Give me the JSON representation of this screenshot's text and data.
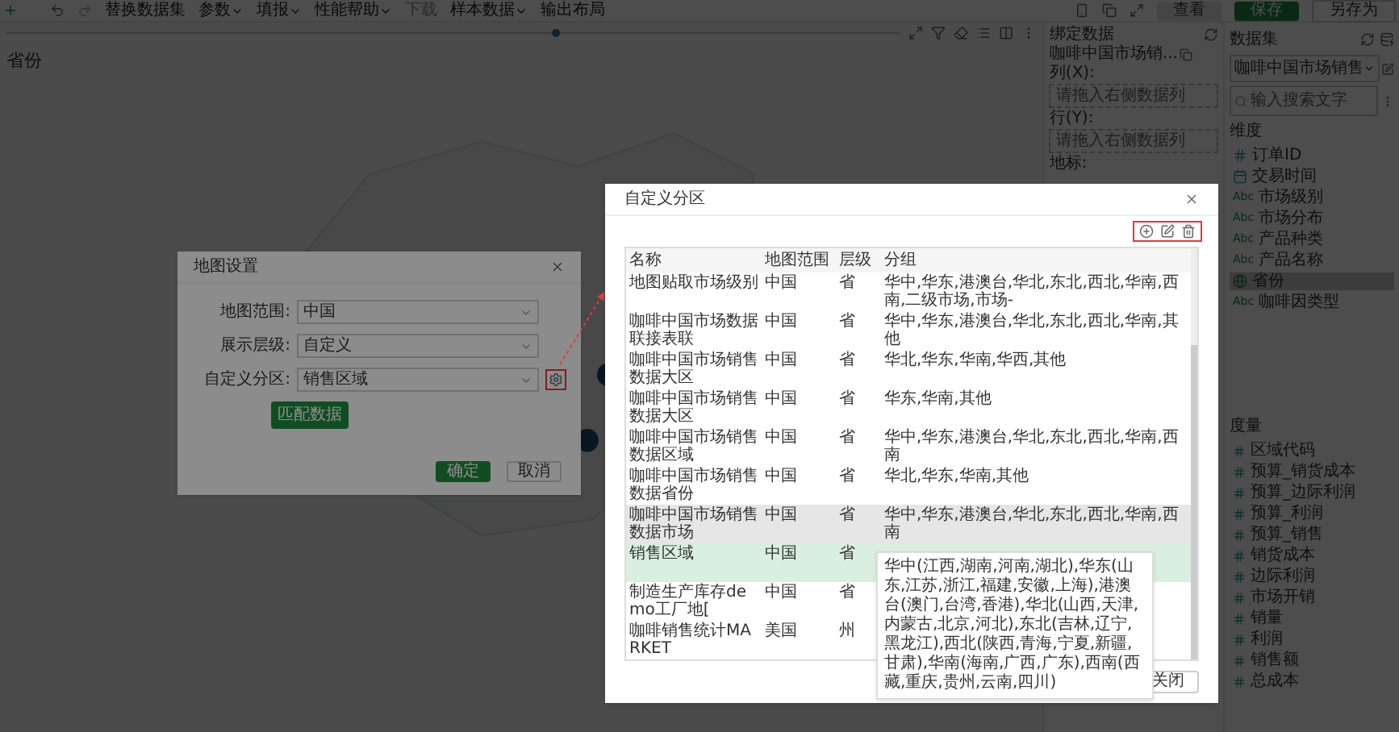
{
  "toolbar": {
    "menus": [
      {
        "label": "替换数据集",
        "dropdown": false,
        "disabled": false
      },
      {
        "label": "参数",
        "dropdown": true,
        "disabled": false
      },
      {
        "label": "填报",
        "dropdown": true,
        "disabled": false
      },
      {
        "label": "性能帮助",
        "dropdown": true,
        "disabled": false
      },
      {
        "label": "下载",
        "dropdown": false,
        "disabled": true
      },
      {
        "label": "样本数据",
        "dropdown": true,
        "disabled": false
      },
      {
        "label": "输出布局",
        "dropdown": false,
        "disabled": false
      }
    ],
    "actions": [
      {
        "label": "查看",
        "kind": "plain"
      },
      {
        "label": "保存",
        "kind": "primary"
      },
      {
        "label": "另存为",
        "kind": "outline"
      }
    ]
  },
  "chart": {
    "title": "省份"
  },
  "binding_panel": {
    "title": "绑定数据",
    "dataset": "咖啡中国市场销...",
    "sections": [
      {
        "label": "列(X):",
        "placeholder": "请拖入右侧数据列"
      },
      {
        "label": "行(Y):",
        "placeholder": "请拖入右侧数据列"
      }
    ],
    "marker_label": "地标:"
  },
  "dataset_panel": {
    "title": "数据集",
    "dataset": "咖啡中国市场销售",
    "search": {
      "placeholder": "输入搜索文字"
    },
    "dimensions": {
      "title": "维度",
      "items": [
        {
          "name": "订单ID",
          "kind": "number",
          "selected": false
        },
        {
          "name": "交易时间",
          "kind": "date",
          "selected": false
        },
        {
          "name": "市场级别",
          "kind": "text",
          "badge": "Abc",
          "selected": false
        },
        {
          "name": "市场分布",
          "kind": "text",
          "badge": "Abc",
          "selected": false
        },
        {
          "name": "产品种类",
          "kind": "text",
          "badge": "Abc",
          "selected": false
        },
        {
          "name": "产品名称",
          "kind": "text",
          "badge": "Abc",
          "selected": false
        },
        {
          "name": "省份",
          "kind": "geo",
          "selected": true
        },
        {
          "name": "咖啡因类型",
          "kind": "text",
          "badge": "Abc",
          "selected": false
        }
      ]
    },
    "measures": {
      "title": "度量",
      "items": [
        "区域代码",
        "预算_销货成本",
        "预算_边际利润",
        "预算_利润",
        "预算_销售",
        "销货成本",
        "边际利润",
        "市场开销",
        "销量",
        "利润",
        "销售额",
        "总成本"
      ]
    }
  },
  "map_settings_dialog": {
    "title": "地图设置",
    "fields": [
      {
        "label": "地图范围:",
        "value": "中国",
        "settings": false
      },
      {
        "label": "展示层级:",
        "value": "自定义",
        "settings": false
      },
      {
        "label": "自定义分区:",
        "value": "销售区域",
        "settings": true
      }
    ],
    "match_button": "匹配数据",
    "buttons": [
      {
        "label": "确定",
        "kind": "primary"
      },
      {
        "label": "取消",
        "kind": "secondary"
      }
    ]
  },
  "custom_partition_dialog": {
    "title": "自定义分区",
    "columns": [
      "名称",
      "地图范围",
      "层级",
      "分组"
    ],
    "rows": [
      {
        "name": "地图贴取市场级别",
        "range": "中国",
        "level": "省",
        "group": "华中,华东,港澳台,华北,东北,西北,华南,西南,二级市场,市场-",
        "selected": false,
        "hovered": false
      },
      {
        "name": "咖啡中国市场数据联接表联",
        "range": "中国",
        "level": "省",
        "group": "华中,华东,港澳台,华北,东北,西北,华南,其他",
        "selected": false,
        "hovered": false
      },
      {
        "name": "咖啡中国市场销售数据大区",
        "range": "中国",
        "level": "省",
        "group": "华北,华东,华南,华西,其他",
        "selected": false,
        "hovered": false
      },
      {
        "name": "咖啡中国市场销售数据大区",
        "range": "中国",
        "level": "省",
        "group": "华东,华南,其他",
        "selected": false,
        "hovered": false
      },
      {
        "name": "咖啡中国市场销售数据区域",
        "range": "中国",
        "level": "省",
        "group": "华中,华东,港澳台,华北,东北,西北,华南,西南",
        "selected": false,
        "hovered": false
      },
      {
        "name": "咖啡中国市场销售数据省份",
        "range": "中国",
        "level": "省",
        "group": "华北,华东,华南,其他",
        "selected": false,
        "hovered": false
      },
      {
        "name": "咖啡中国市场销售数据市场",
        "range": "中国",
        "level": "省",
        "group": "华中,华东,港澳台,华北,东北,西北,华南,西南",
        "selected": false,
        "hovered": true
      },
      {
        "name": "销售区域",
        "range": "中国",
        "level": "省",
        "selected": true,
        "hovered": false
      },
      {
        "name": "制造生产库存demo工厂地[",
        "range": "中国",
        "level": "省",
        "selected": false,
        "hovered": false
      },
      {
        "name": "咖啡销售统计MARKET",
        "range": "美国",
        "level": "州",
        "selected": false,
        "hovered": false
      }
    ],
    "tooltip": "华中(江西,湖南,河南,湖北),华东(山东,江苏,浙江,福建,安徽,上海),港澳台(澳门,台湾,香港),华北(山西,天津,内蒙古,北京,河北),东北(吉林,辽宁,黑龙江),西北(陕西,青海,宁夏,新疆,甘肃),华南(海南,广西,广东),西南(西藏,重庆,贵州,云南,四川)",
    "buttons": [
      "关闭"
    ]
  }
}
